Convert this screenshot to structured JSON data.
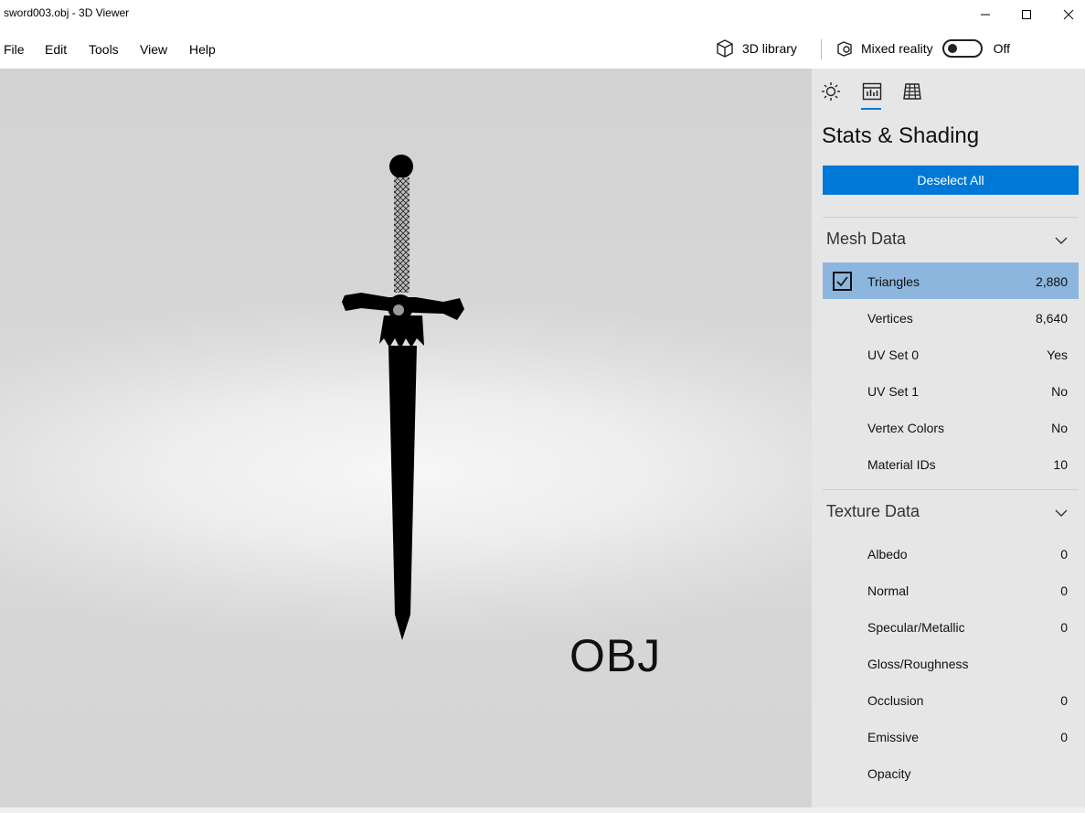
{
  "window": {
    "title": "sword003.obj - 3D Viewer"
  },
  "menu": {
    "items": [
      "File",
      "Edit",
      "Tools",
      "View",
      "Help"
    ]
  },
  "toolbar": {
    "library_label": "3D library",
    "mixed_reality_label": "Mixed reality",
    "toggle_state": "Off"
  },
  "viewport": {
    "format_label": "OBJ"
  },
  "panel": {
    "tabs": [
      "lighting-tab",
      "stats-tab",
      "grid-tab"
    ],
    "title": "Stats & Shading",
    "deselect_label": "Deselect All",
    "mesh_section": "Mesh Data",
    "mesh_rows": [
      {
        "label": "Triangles",
        "value": "2,880"
      },
      {
        "label": "Vertices",
        "value": "8,640"
      },
      {
        "label": "UV Set 0",
        "value": "Yes"
      },
      {
        "label": "UV Set 1",
        "value": "No"
      },
      {
        "label": "Vertex Colors",
        "value": "No"
      },
      {
        "label": "Material IDs",
        "value": "10"
      }
    ],
    "texture_section": "Texture Data",
    "texture_rows": [
      {
        "label": "Albedo",
        "value": "0"
      },
      {
        "label": "Normal",
        "value": "0"
      },
      {
        "label": "Specular/Metallic",
        "value": "0"
      },
      {
        "label": "Gloss/Roughness",
        "value": ""
      },
      {
        "label": "Occlusion",
        "value": "0"
      },
      {
        "label": "Emissive",
        "value": "0"
      },
      {
        "label": "Opacity",
        "value": ""
      }
    ]
  },
  "colors": {
    "accent": "#0078d7",
    "selected_row": "#8cb6dd"
  }
}
